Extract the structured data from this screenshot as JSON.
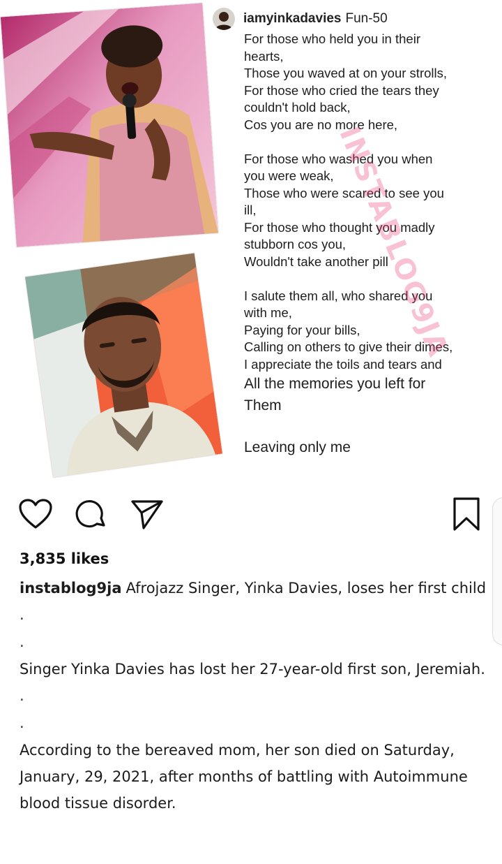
{
  "poem": {
    "username": "iamyinkadavies",
    "title": "Fun-50",
    "lines": [
      "For those who held you in their",
      "hearts,",
      "Those you waved at on your strolls,",
      "For those who cried the tears they",
      "couldn't hold back,",
      "Cos you are no more here,",
      "",
      "For those who washed you when",
      "you were weak,",
      "Those who were scared to see you",
      "ill,",
      "For those who thought you madly",
      "stubborn cos you,",
      "Wouldn't take another pill",
      "",
      "I salute them all, who shared you",
      "with me,",
      "Paying for your bills,",
      "Calling on others to give their dimes,",
      "I appreciate the toils and tears and"
    ],
    "big_lines": [
      "All the memories you left for",
      "Them",
      "",
      "Leaving only me"
    ],
    "watermark": "INSTABLOG9JA"
  },
  "actions": {
    "like_icon": "heart-icon",
    "comment_icon": "comment-icon",
    "share_icon": "send-icon",
    "save_icon": "bookmark-icon"
  },
  "likes": "3,835 likes",
  "caption": {
    "username": "instablog9ja",
    "text": "Afrojazz Singer, Yinka Davies, loses her first child",
    "dot1": ".",
    "dot2": ".",
    "para2": "Singer Yinka Davies has lost her 27-year-old first son, Jeremiah.",
    "dot3": ".",
    "dot4": ".",
    "para3": "According to the bereaved mom, her son died on Saturday, January, 29, 2021, after months of battling with Autoimmune blood tissue disorder."
  },
  "colors": {
    "watermark": "#ec407a",
    "text": "#111111",
    "stage_pink": "#e8a7c3",
    "stage_orange": "#f26a3a"
  }
}
